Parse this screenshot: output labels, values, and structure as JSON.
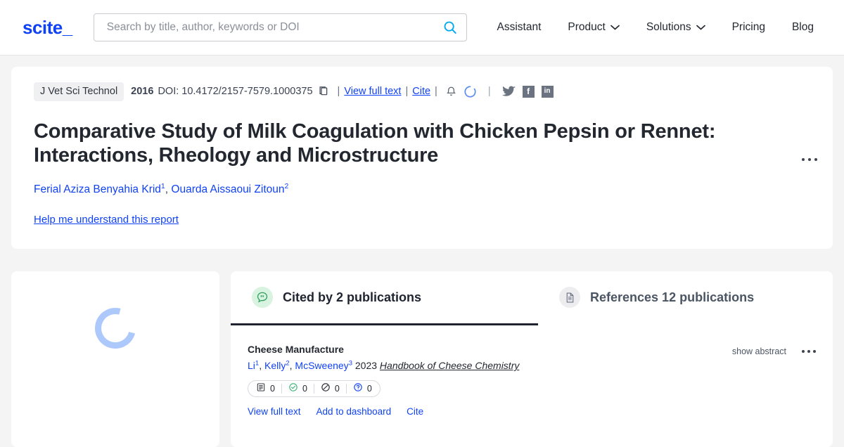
{
  "header": {
    "logo": "scite_",
    "search": {
      "placeholder": "Search by title, author, keywords or DOI",
      "value": "",
      "icon": "search-icon"
    },
    "nav": [
      {
        "label": "Assistant",
        "caret": false
      },
      {
        "label": "Product",
        "caret": true,
        "caret_glyph": "⌄"
      },
      {
        "label": "Solutions",
        "caret": true,
        "caret_glyph": "⌄"
      },
      {
        "label": "Pricing",
        "caret": false
      },
      {
        "label": "Blog",
        "caret": false
      }
    ]
  },
  "article": {
    "journal": "J Vet Sci Technol",
    "year": "2016",
    "doi": "DOI: 10.4172/2157-7579.1000375",
    "copy_icon": "copy-icon",
    "sep1": "|",
    "view_full_text": "View full text",
    "sep2": "|",
    "cite": "Cite",
    "sep3": "|",
    "bell_icon": "bell-icon",
    "spinner_icon": "loading-spinner-icon",
    "social_sep": "|",
    "social": [
      {
        "name": "twitter-icon",
        "glyph": ""
      },
      {
        "name": "facebook-icon",
        "glyph": "f"
      },
      {
        "name": "linkedin-icon",
        "glyph": "in"
      }
    ],
    "title": "Comparative Study of Milk Coagulation with Chicken Pepsin or Rennet: Interactions, Rheology and Microstructure",
    "authors": [
      {
        "name": "Ferial Aziza Benyahia Krid",
        "sup": "1"
      },
      {
        "name": "Ouarda Aissaoui Zitoun",
        "sup": "2"
      }
    ],
    "author_separator": ", ",
    "help_link": "Help me understand this report",
    "overflow_menu": "more-options"
  },
  "side_panel": {
    "loading_icon": "loading-spinner-icon"
  },
  "tabs": [
    {
      "label": "Cited by 2 publications",
      "icon": "quote-bubble-icon",
      "active": true
    },
    {
      "label": "References 12 publications",
      "icon": "document-icon",
      "active": false
    }
  ],
  "citations": [
    {
      "title": "Cheese Manufacture",
      "authors": [
        {
          "name": "Li",
          "sup": "1"
        },
        {
          "name": "Kelly",
          "sup": "2"
        },
        {
          "name": "McSweeney",
          "sup": "3"
        }
      ],
      "year": "2023",
      "journal": "Handbook of Cheese Chemistry",
      "badges": [
        {
          "icon": "mentioning-icon",
          "count": "0"
        },
        {
          "icon": "supporting-icon",
          "count": "0"
        },
        {
          "icon": "contrasting-icon",
          "count": "0"
        },
        {
          "icon": "unclassified-icon",
          "count": "0"
        }
      ],
      "links": [
        "View full text",
        "Add to dashboard",
        "Cite"
      ],
      "show_abstract": "show abstract",
      "overflow_menu": "more-options"
    }
  ],
  "colors": {
    "brand_blue": "#1042f5",
    "search_icon_blue": "#00a8f0",
    "page_bg": "#f4f4f5",
    "card_bg": "#ffffff",
    "text_dark": "#23272f",
    "supporting_green": "#3bb273",
    "tab_active_underline": "#1f2430"
  }
}
